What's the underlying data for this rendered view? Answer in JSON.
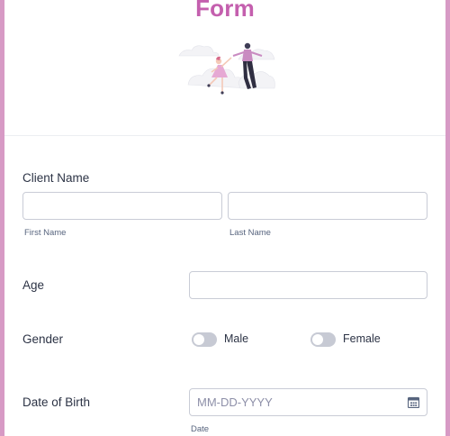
{
  "form": {
    "title": "Form",
    "client_name": {
      "label": "Client Name",
      "first_sublabel": "First Name",
      "last_sublabel": "Last Name",
      "first_value": "",
      "last_value": ""
    },
    "age": {
      "label": "Age",
      "value": ""
    },
    "gender": {
      "label": "Gender",
      "options": [
        "Male",
        "Female"
      ]
    },
    "dob": {
      "label": "Date of Birth",
      "placeholder": "MM-DD-YYYY",
      "sublabel": "Date",
      "icon": "calendar-icon"
    }
  },
  "colors": {
    "accent": "#c45fae",
    "frame": "#d79ac5",
    "toggle_off": "#c7cad4"
  }
}
